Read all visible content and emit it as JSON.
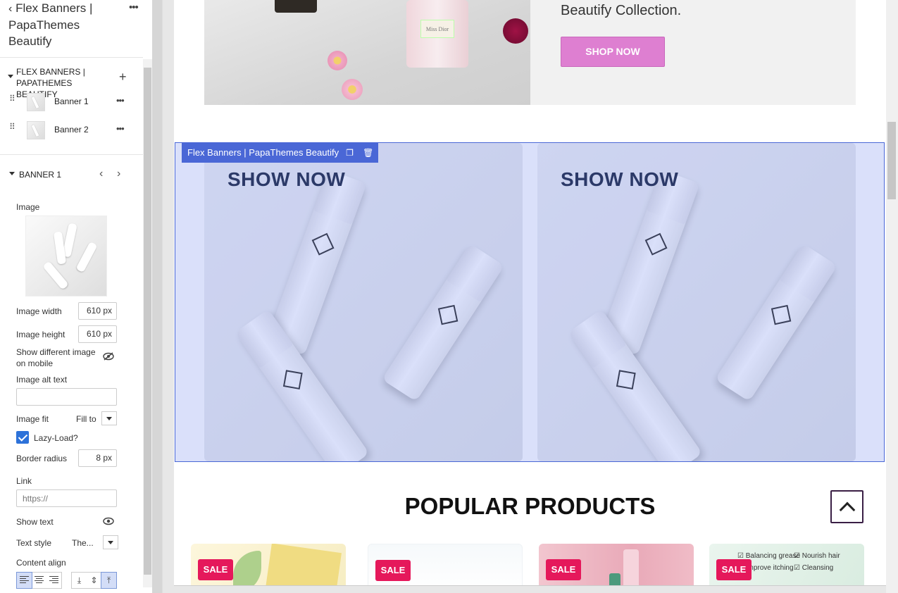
{
  "panel": {
    "title": "Flex Banners | PapaThemes Beautify",
    "section_title": "FLEX BANNERS | PAPATHEMES BEAUTIFY",
    "blocks": [
      {
        "label": "Banner 1"
      },
      {
        "label": "Banner 2"
      }
    ],
    "block_section": "BANNER 1",
    "fields": {
      "image_label": "Image",
      "image_width_label": "Image width",
      "image_width_value": "610 px",
      "image_height_label": "Image height",
      "image_height_value": "610 px",
      "show_mobile_label": "Show different image on mobile",
      "alt_text_label": "Image alt text",
      "alt_text_value": "",
      "image_fit_label": "Image fit",
      "image_fit_value": "Fill to",
      "lazy_load_label": "Lazy-Load?",
      "lazy_load_checked": true,
      "border_radius_label": "Border radius",
      "border_radius_value": "8 px",
      "link_label": "Link",
      "link_placeholder": "https://",
      "show_text_label": "Show text",
      "text_style_label": "Text style",
      "text_style_value": "The...",
      "content_align_label": "Content align"
    }
  },
  "canvas": {
    "hero_text": "Beautify Collection.",
    "hero_button": "SHOP NOW",
    "section_label": "Flex Banners | PapaThemes Beautify",
    "banners": [
      {
        "cta": "SHOW NOW"
      },
      {
        "cta": "SHOW NOW"
      }
    ],
    "popular_title": "POPULAR PRODUCTS",
    "products": [
      {
        "badge": "SALE"
      },
      {
        "badge": "SALE"
      },
      {
        "badge": "SALE"
      },
      {
        "badge": "SALE",
        "features": [
          "Balancing grease",
          "Nourish hair",
          "Improve itching",
          "Cleansing"
        ]
      }
    ]
  },
  "colors": {
    "accent": "#4a67d6",
    "shop_button": "#de7fd1",
    "sale_badge": "#e5185b"
  }
}
